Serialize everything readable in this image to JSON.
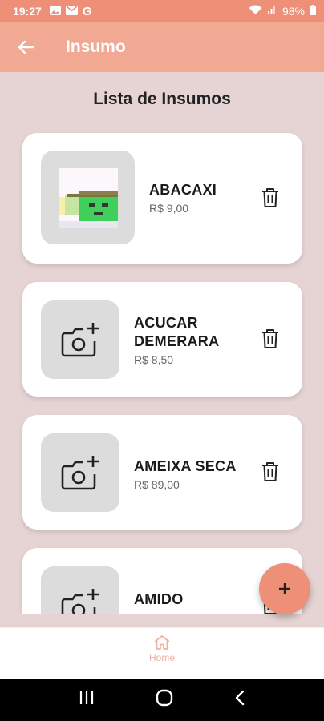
{
  "status_bar": {
    "time": "19:27",
    "battery": "98%"
  },
  "app_bar": {
    "title": "Insumo"
  },
  "list_title": "Lista de Insumos",
  "items": [
    {
      "name": "ABACAXI",
      "price": "R$ 9,00"
    },
    {
      "name": "ACUCAR DEMERARA",
      "price": "R$ 8,50"
    },
    {
      "name": "AMEIXA SECA",
      "price": "R$ 89,00"
    },
    {
      "name": "AMIDO",
      "price": ""
    }
  ],
  "bottom_nav": {
    "home_label": "Home"
  },
  "colors": {
    "primary": "#ee8f78",
    "app_bar": "#f1a993",
    "background": "#e6d3d3"
  }
}
